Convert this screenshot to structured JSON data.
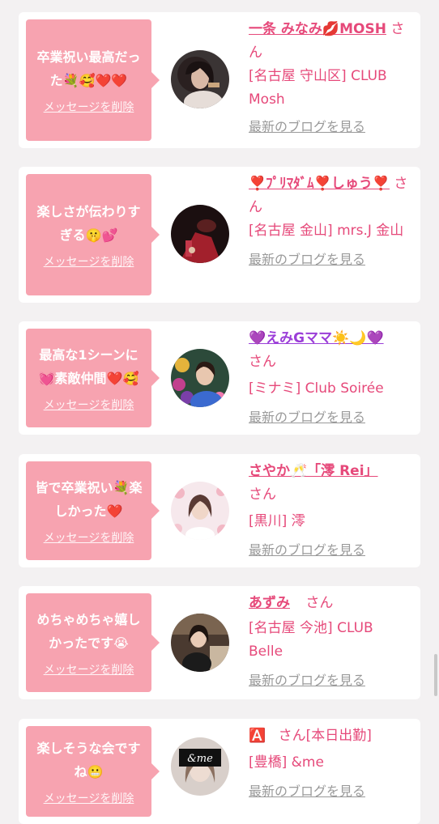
{
  "cards": [
    {
      "message": "卒業祝い最高だった💐🥰❤️❤️",
      "delete_label": "メッセージを削除",
      "name": "一条 みなみ💋MOSH",
      "suffix": "さん",
      "area": "[名古屋 守山区] CLUB Mosh",
      "blog_label": "最新のブログを見る",
      "avatar_icon": "woman-portrait-dark"
    },
    {
      "message": "楽しさが伝わりすぎる🤫💕",
      "delete_label": "メッセージを削除",
      "name": "❣️ﾌﾟﾘﾏﾀﾞﾑ❣️しゅう❣️",
      "suffix": "さん",
      "area": "[名古屋 金山] mrs.J 金山",
      "blog_label": "最新のブログを見る",
      "avatar_icon": "red-dress-photo"
    },
    {
      "message": "最高な1シーンに💓素敵仲間❤️🥰",
      "delete_label": "メッセージを削除",
      "name": "💜えみGママ☀️🌙💜",
      "suffix": "さん",
      "area": "[ミナミ] Club Soirée",
      "blog_label": "最新のブログを見る",
      "avatar_icon": "woman-with-flowers"
    },
    {
      "message": "皆で卒業祝い💐楽しかった❤️",
      "delete_label": "メッセージを削除",
      "name": "さやか🥂「澪 Rei」",
      "suffix": "さん",
      "area": "[黒川] 澪",
      "blog_label": "最新のブログを見る",
      "avatar_icon": "woman-floral-frame"
    },
    {
      "message": "めちゃめちゃ嬉しかったです😭",
      "delete_label": "メッセージを削除",
      "name": "あずみ",
      "suffix": "さん",
      "area": "[名古屋 今池] CLUB Belle",
      "blog_label": "最新のブログを見る",
      "avatar_icon": "woman-indoor-photo"
    },
    {
      "message": "楽しそうな会ですね😬",
      "delete_label": "メッセージを削除",
      "name": "🅰️",
      "suffix": "さん[本日出勤]",
      "area": "[豊橋] &me",
      "blog_label": "最新のブログを見る",
      "avatar_icon": "me-logo-photo",
      "avatar_text": "&me"
    }
  ]
}
